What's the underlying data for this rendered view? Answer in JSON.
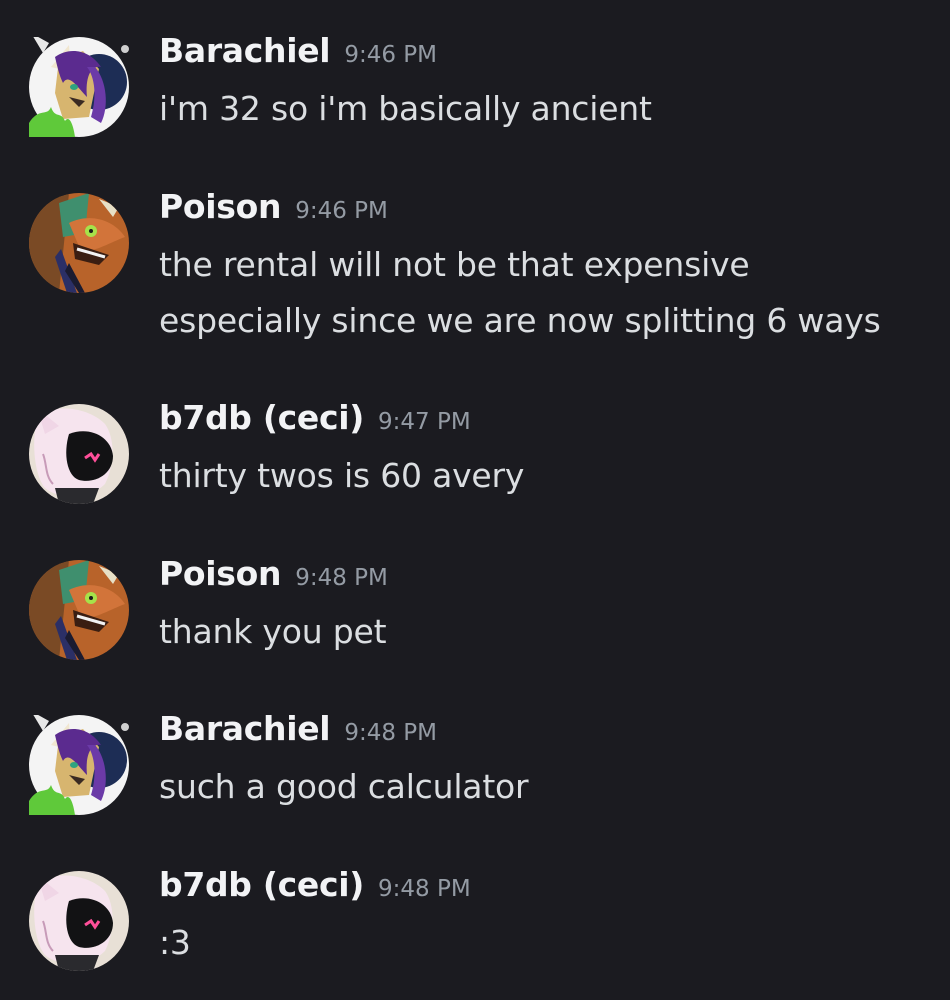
{
  "messages": [
    {
      "avatar": "wolf-avatar-purple-hair",
      "username": "Barachiel",
      "time": "9:46 PM",
      "lines": [
        "i'm 32 so i'm basically ancient"
      ]
    },
    {
      "avatar": "lizard-avatar-orange",
      "username": "Poison",
      "time": "9:46 PM",
      "lines": [
        "the rental will not be that expensive",
        "especially since we are now splitting 6 ways"
      ]
    },
    {
      "avatar": "protogen-avatar-pink",
      "username": "b7db (ceci)",
      "time": "9:47 PM",
      "lines": [
        "thirty twos is 60 avery"
      ]
    },
    {
      "avatar": "lizard-avatar-orange",
      "username": "Poison",
      "time": "9:48 PM",
      "lines": [
        "thank you pet"
      ]
    },
    {
      "avatar": "wolf-avatar-purple-hair",
      "username": "Barachiel",
      "time": "9:48 PM",
      "lines": [
        "such a good calculator"
      ]
    },
    {
      "avatar": "protogen-avatar-pink",
      "username": "b7db (ceci)",
      "time": "9:48 PM",
      "lines": [
        ":3"
      ]
    }
  ],
  "colors": {
    "background": "#1b1b20",
    "username": "#f2f3f5",
    "timestamp": "#949ba4",
    "message_text": "#dbdee1"
  }
}
